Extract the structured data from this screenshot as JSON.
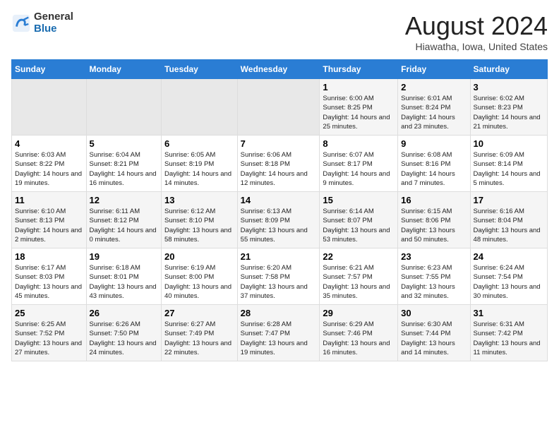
{
  "logo": {
    "general": "General",
    "blue": "Blue"
  },
  "title": "August 2024",
  "subtitle": "Hiawatha, Iowa, United States",
  "days": [
    "Sunday",
    "Monday",
    "Tuesday",
    "Wednesday",
    "Thursday",
    "Friday",
    "Saturday"
  ],
  "weeks": [
    [
      {
        "day": "",
        "data": ""
      },
      {
        "day": "",
        "data": ""
      },
      {
        "day": "",
        "data": ""
      },
      {
        "day": "",
        "data": ""
      },
      {
        "day": "1",
        "data": "Sunrise: 6:00 AM\nSunset: 8:25 PM\nDaylight: 14 hours and 25 minutes."
      },
      {
        "day": "2",
        "data": "Sunrise: 6:01 AM\nSunset: 8:24 PM\nDaylight: 14 hours and 23 minutes."
      },
      {
        "day": "3",
        "data": "Sunrise: 6:02 AM\nSunset: 8:23 PM\nDaylight: 14 hours and 21 minutes."
      }
    ],
    [
      {
        "day": "4",
        "data": "Sunrise: 6:03 AM\nSunset: 8:22 PM\nDaylight: 14 hours and 19 minutes."
      },
      {
        "day": "5",
        "data": "Sunrise: 6:04 AM\nSunset: 8:21 PM\nDaylight: 14 hours and 16 minutes."
      },
      {
        "day": "6",
        "data": "Sunrise: 6:05 AM\nSunset: 8:19 PM\nDaylight: 14 hours and 14 minutes."
      },
      {
        "day": "7",
        "data": "Sunrise: 6:06 AM\nSunset: 8:18 PM\nDaylight: 14 hours and 12 minutes."
      },
      {
        "day": "8",
        "data": "Sunrise: 6:07 AM\nSunset: 8:17 PM\nDaylight: 14 hours and 9 minutes."
      },
      {
        "day": "9",
        "data": "Sunrise: 6:08 AM\nSunset: 8:16 PM\nDaylight: 14 hours and 7 minutes."
      },
      {
        "day": "10",
        "data": "Sunrise: 6:09 AM\nSunset: 8:14 PM\nDaylight: 14 hours and 5 minutes."
      }
    ],
    [
      {
        "day": "11",
        "data": "Sunrise: 6:10 AM\nSunset: 8:13 PM\nDaylight: 14 hours and 2 minutes."
      },
      {
        "day": "12",
        "data": "Sunrise: 6:11 AM\nSunset: 8:12 PM\nDaylight: 14 hours and 0 minutes."
      },
      {
        "day": "13",
        "data": "Sunrise: 6:12 AM\nSunset: 8:10 PM\nDaylight: 13 hours and 58 minutes."
      },
      {
        "day": "14",
        "data": "Sunrise: 6:13 AM\nSunset: 8:09 PM\nDaylight: 13 hours and 55 minutes."
      },
      {
        "day": "15",
        "data": "Sunrise: 6:14 AM\nSunset: 8:07 PM\nDaylight: 13 hours and 53 minutes."
      },
      {
        "day": "16",
        "data": "Sunrise: 6:15 AM\nSunset: 8:06 PM\nDaylight: 13 hours and 50 minutes."
      },
      {
        "day": "17",
        "data": "Sunrise: 6:16 AM\nSunset: 8:04 PM\nDaylight: 13 hours and 48 minutes."
      }
    ],
    [
      {
        "day": "18",
        "data": "Sunrise: 6:17 AM\nSunset: 8:03 PM\nDaylight: 13 hours and 45 minutes."
      },
      {
        "day": "19",
        "data": "Sunrise: 6:18 AM\nSunset: 8:01 PM\nDaylight: 13 hours and 43 minutes."
      },
      {
        "day": "20",
        "data": "Sunrise: 6:19 AM\nSunset: 8:00 PM\nDaylight: 13 hours and 40 minutes."
      },
      {
        "day": "21",
        "data": "Sunrise: 6:20 AM\nSunset: 7:58 PM\nDaylight: 13 hours and 37 minutes."
      },
      {
        "day": "22",
        "data": "Sunrise: 6:21 AM\nSunset: 7:57 PM\nDaylight: 13 hours and 35 minutes."
      },
      {
        "day": "23",
        "data": "Sunrise: 6:23 AM\nSunset: 7:55 PM\nDaylight: 13 hours and 32 minutes."
      },
      {
        "day": "24",
        "data": "Sunrise: 6:24 AM\nSunset: 7:54 PM\nDaylight: 13 hours and 30 minutes."
      }
    ],
    [
      {
        "day": "25",
        "data": "Sunrise: 6:25 AM\nSunset: 7:52 PM\nDaylight: 13 hours and 27 minutes."
      },
      {
        "day": "26",
        "data": "Sunrise: 6:26 AM\nSunset: 7:50 PM\nDaylight: 13 hours and 24 minutes."
      },
      {
        "day": "27",
        "data": "Sunrise: 6:27 AM\nSunset: 7:49 PM\nDaylight: 13 hours and 22 minutes."
      },
      {
        "day": "28",
        "data": "Sunrise: 6:28 AM\nSunset: 7:47 PM\nDaylight: 13 hours and 19 minutes."
      },
      {
        "day": "29",
        "data": "Sunrise: 6:29 AM\nSunset: 7:46 PM\nDaylight: 13 hours and 16 minutes."
      },
      {
        "day": "30",
        "data": "Sunrise: 6:30 AM\nSunset: 7:44 PM\nDaylight: 13 hours and 14 minutes."
      },
      {
        "day": "31",
        "data": "Sunrise: 6:31 AM\nSunset: 7:42 PM\nDaylight: 13 hours and 11 minutes."
      }
    ]
  ]
}
